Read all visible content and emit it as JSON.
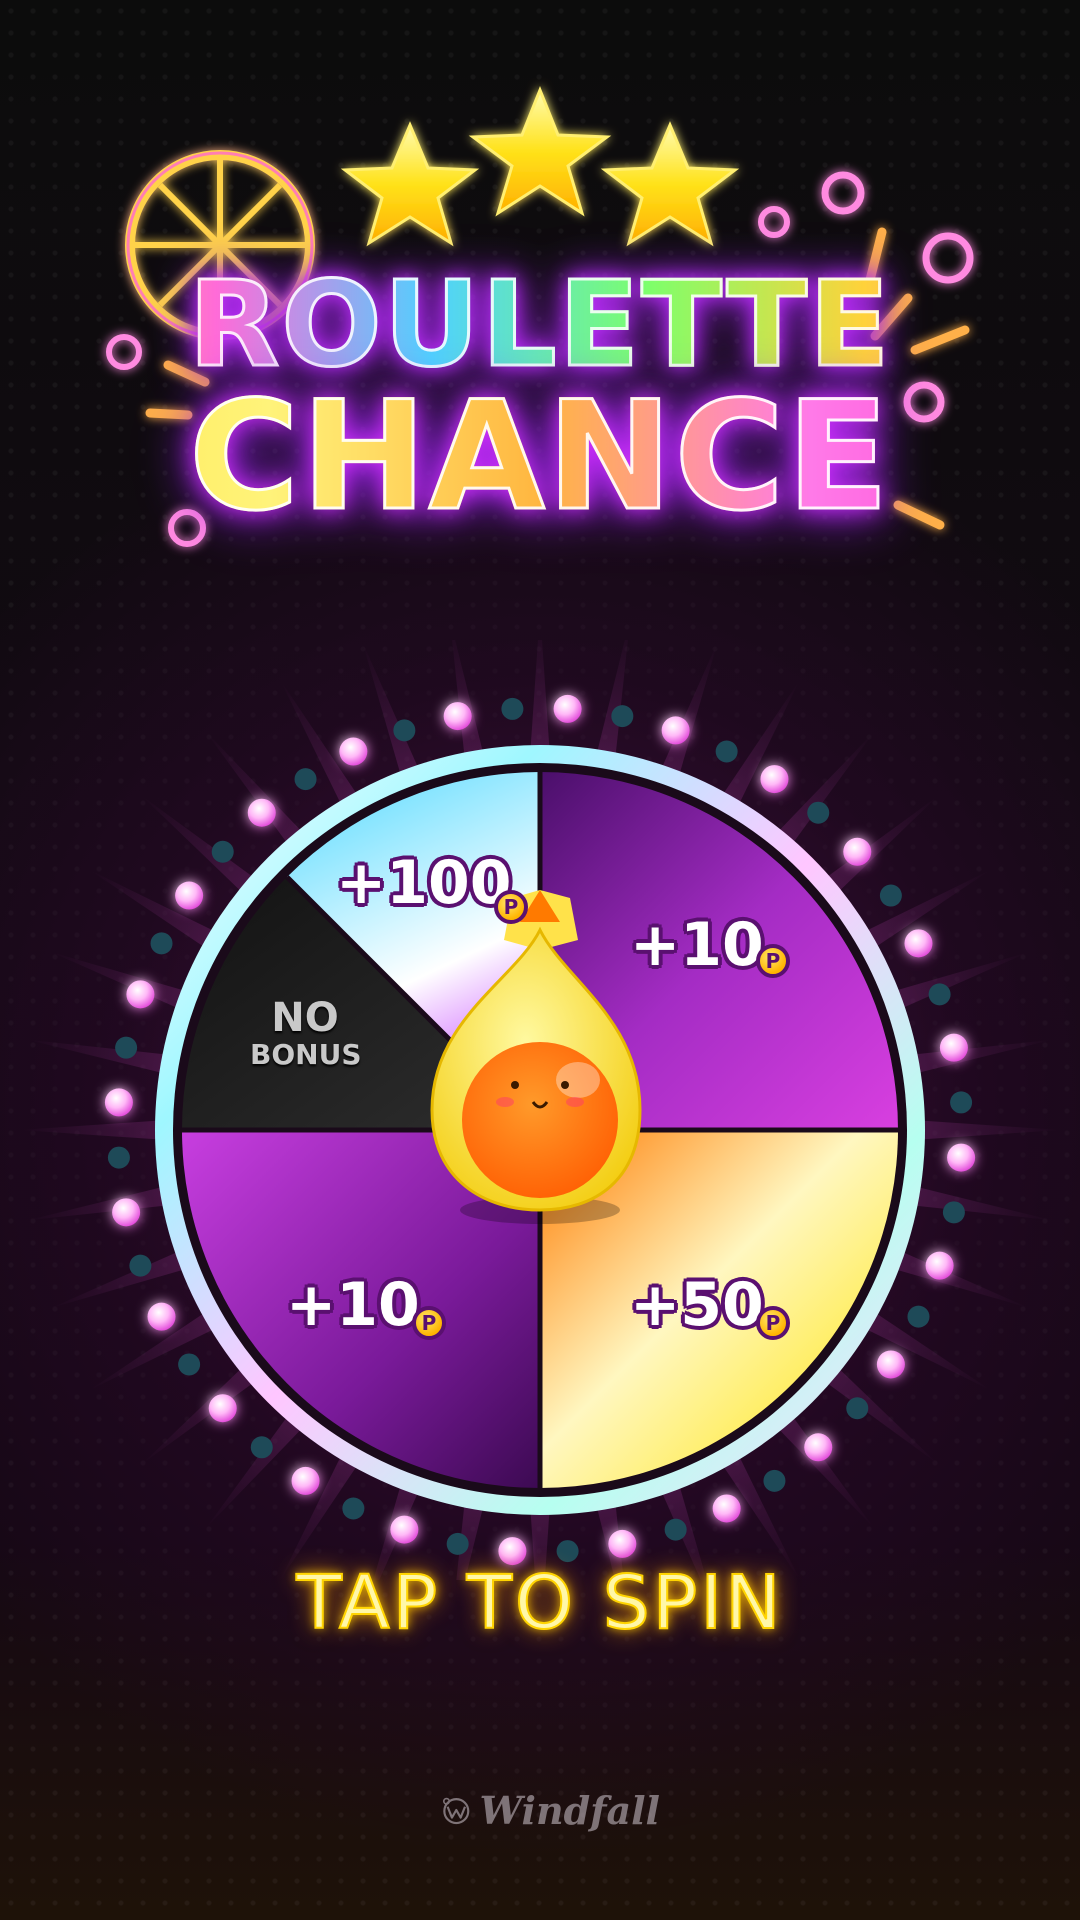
{
  "title": {
    "line1": "ROULETTE",
    "line2": "CHANCE",
    "stars": 3
  },
  "wheel": {
    "segments": [
      {
        "label": "+100",
        "coin": true,
        "colors": [
          "#7fe3ff",
          "#ffffff",
          "#c23cff"
        ]
      },
      {
        "label": "+10",
        "coin": true,
        "colors": [
          "#4a0f6a",
          "#a42cc4",
          "#d83fe0"
        ]
      },
      {
        "label": "+50",
        "coin": true,
        "colors": [
          "#ff7a00",
          "#fff7c0",
          "#ffe400"
        ]
      },
      {
        "label": "+10",
        "coin": true,
        "colors": [
          "#c83ee0",
          "#7a1a9a",
          "#3c0a52"
        ]
      },
      {
        "label_line1": "NO",
        "label_line2": "BONUS",
        "coin": false,
        "colors": [
          "#121212",
          "#2a2a2a"
        ]
      }
    ],
    "coin_symbol": "P",
    "center_character": "orange-blob-mascot"
  },
  "cta": {
    "label": "TAP TO SPIN"
  },
  "brand": {
    "name": "Windfall",
    "icon": "windfall-logo-icon"
  },
  "colors": {
    "accent_purple": "#c230ff",
    "accent_yellow": "#ffd400",
    "bulb": "#ff9cf5",
    "bulb_dim": "#1e4a58"
  }
}
